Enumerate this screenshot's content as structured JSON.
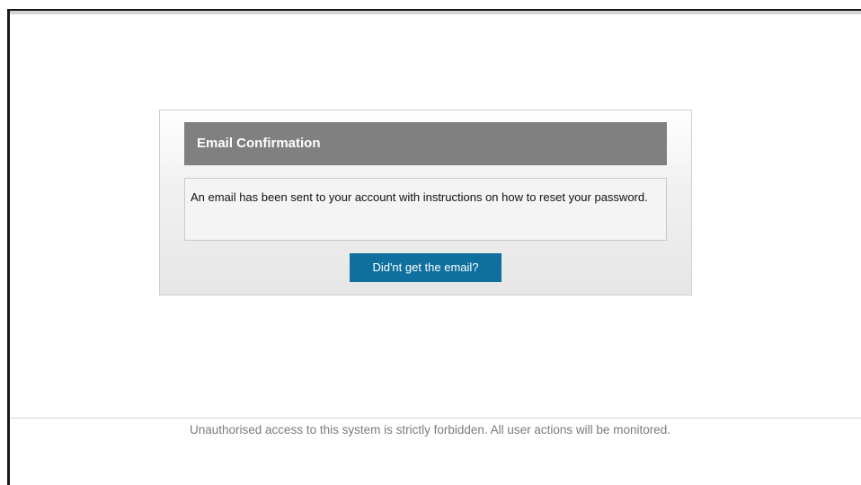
{
  "dialog": {
    "title": "Email Confirmation",
    "message": "An email has been sent to your account with instructions on how to reset your password.",
    "resend_button_label": "Did'nt get the email?"
  },
  "footer": {
    "notice": "Unauthorised access to this system is strictly forbidden. All user actions will be monitored."
  },
  "colors": {
    "header_bg": "#808080",
    "button_bg": "#0f6f9e",
    "footer_text": "#7b7b7b"
  }
}
